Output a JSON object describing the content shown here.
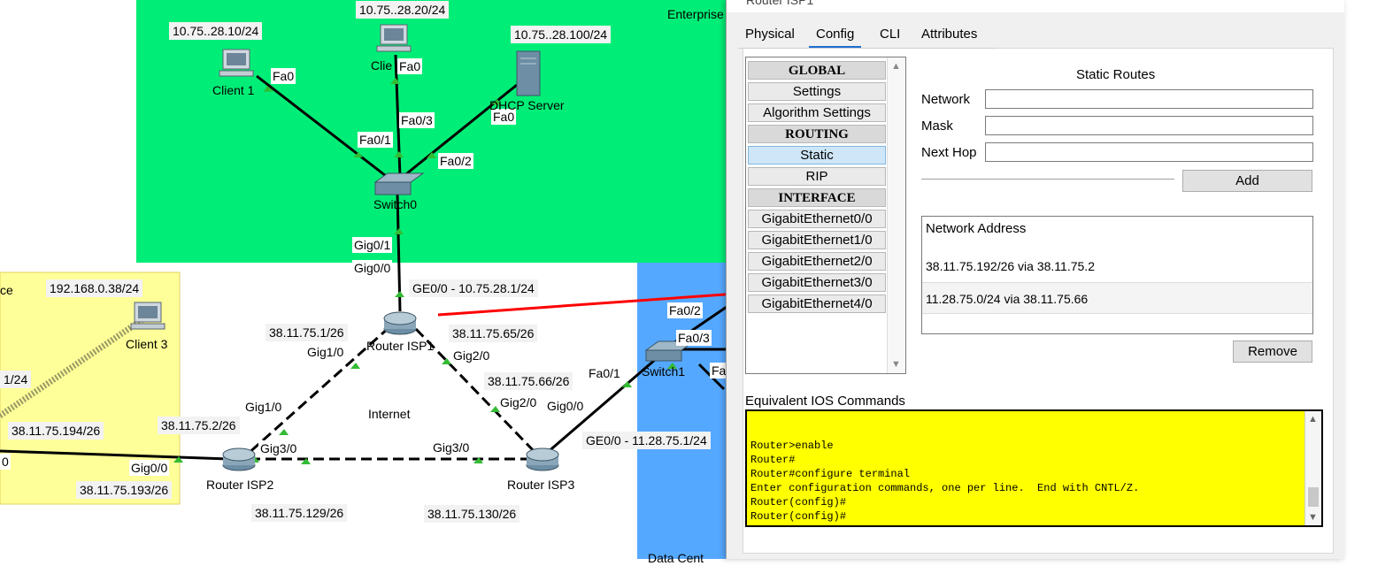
{
  "colors": {
    "enterprise_zone": "#00ee77",
    "home_zone": "#ffff99",
    "datacenter_zone": "#55a8ff",
    "link": "#000000",
    "port_dot": "#33bb33",
    "annotation_arrow": "#ff0000",
    "ios_background": "#ffff00",
    "selected_nav": "#cfe6f8"
  },
  "topology": {
    "zone_labels": {
      "enterprise": "Enterprise",
      "home_partial": "ce",
      "datacenter_partial": "Data Cent"
    },
    "devices": {
      "client1": "Client 1",
      "client_partial": "Clie",
      "dhcp_server": "DHCP Server",
      "switch0": "Switch0",
      "client3": "Client 3",
      "router_isp1": "Router ISP1",
      "router_isp2": "Router ISP2",
      "router_isp3": "Router ISP3",
      "switch1": "Switch1",
      "internet": "Internet"
    },
    "addresses": {
      "client1": "10.75..28.10/24",
      "client2": "10.75..28.20/24",
      "server": "10.75..28.100/24",
      "client3": "192.168.0.38/24",
      "left_partial": "1/24",
      "isp1_ge00": "GE0/0 - 10.75.28.1/24",
      "isp1_gig10": "38.11.75.1/26",
      "isp1_gig20": "38.11.75.65/26",
      "isp3_gig20": "38.11.75.66/26",
      "isp2_gig10": "38.11.75.2/26",
      "home_router": "38.11.75.194/26",
      "isp2_gig00": "38.11.75.193/26",
      "isp2_gig30": "38.11.75.129/26",
      "isp3_gig30": "38.11.75.130/26",
      "isp3_ge00": "GE0/0 - 11.28.75.1/24"
    },
    "ports": {
      "client1_fa0": "Fa0",
      "client2_fa0": "Fa0",
      "server_fa0": "Fa0",
      "sw0_fa01": "Fa0/1",
      "sw0_fa03": "Fa0/3",
      "sw0_fa02": "Fa0/2",
      "sw0_gig01": "Gig0/1",
      "isp1_gig00": "Gig0/0",
      "isp1_gig10": "Gig1/0",
      "isp1_gig20": "Gig2/0",
      "isp2_gig10": "Gig1/0",
      "isp2_gig30": "Gig3/0",
      "isp2_gig00": "Gig0/0",
      "isp3_gig20": "Gig2/0",
      "isp3_gig00": "Gig0/0",
      "isp3_gig30": "Gig3/0",
      "sw1_fa02": "Fa0/2",
      "sw1_fa03": "Fa0/3",
      "sw1_fa01": "Fa0/1",
      "sw1_partial": "Fa",
      "left_partial": "0"
    }
  },
  "dialog": {
    "title": "Router ISP1",
    "tabs": [
      "Physical",
      "Config",
      "CLI",
      "Attributes"
    ],
    "active_tab": "Config",
    "nav": {
      "global_header": "GLOBAL",
      "settings": "Settings",
      "algorithm_settings": "Algorithm Settings",
      "routing_header": "ROUTING",
      "static": "Static",
      "rip": "RIP",
      "interface_header": "INTERFACE",
      "interfaces": [
        "GigabitEthernet0/0",
        "GigabitEthernet1/0",
        "GigabitEthernet2/0",
        "GigabitEthernet3/0",
        "GigabitEthernet4/0"
      ]
    },
    "static_routes": {
      "title": "Static Routes",
      "network_label": "Network",
      "mask_label": "Mask",
      "next_hop_label": "Next Hop",
      "network_value": "",
      "mask_value": "",
      "next_hop_value": "",
      "add_button": "Add",
      "list_header": "Network Address",
      "routes": [
        "38.11.75.192/26 via 38.11.75.2",
        "11.28.75.0/24 via 38.11.75.66"
      ],
      "remove_button": "Remove"
    },
    "ios": {
      "label": "Equivalent IOS Commands",
      "lines": [
        "",
        "",
        "Router>enable",
        "Router#",
        "Router#configure terminal",
        "Enter configuration commands, one per line.  End with CNTL/Z.",
        "Router(config)#",
        "Router(config)#"
      ]
    }
  }
}
